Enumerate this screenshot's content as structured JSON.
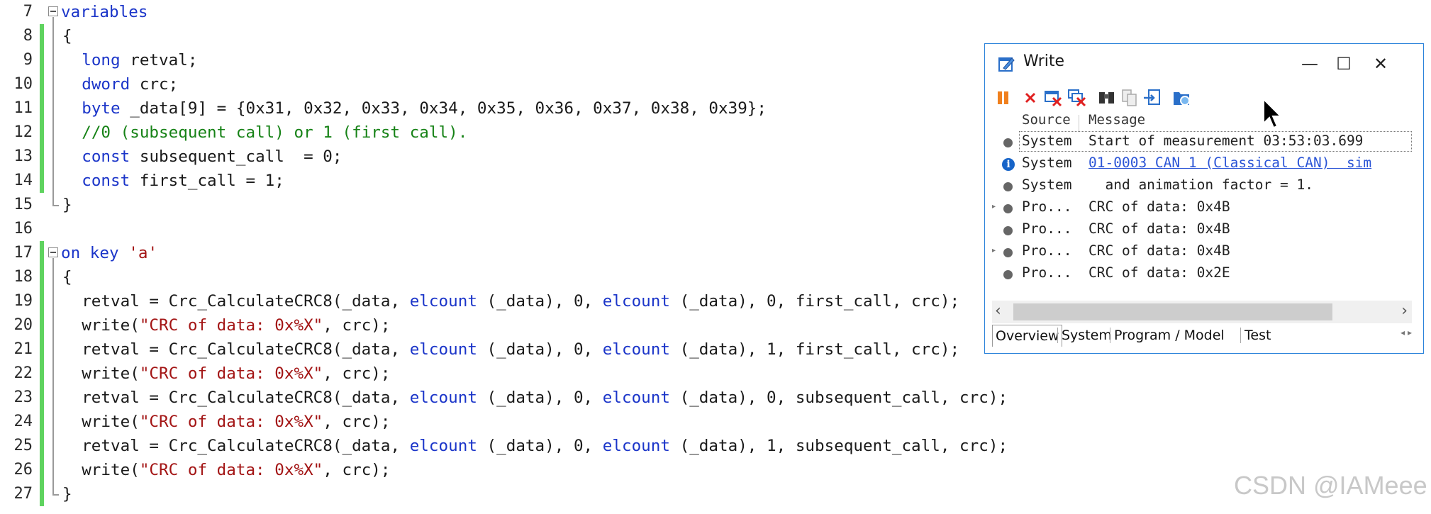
{
  "editor": {
    "lines": [
      {
        "n": "7",
        "tokens": [
          {
            "t": "variables",
            "c": "kw"
          }
        ]
      },
      {
        "n": "8",
        "tokens": [
          {
            "t": "{",
            "c": ""
          }
        ]
      },
      {
        "n": "9",
        "tokens": [
          {
            "t": "  ",
            "c": ""
          },
          {
            "t": "long",
            "c": "kw"
          },
          {
            "t": " retval;",
            "c": ""
          }
        ]
      },
      {
        "n": "10",
        "tokens": [
          {
            "t": "  ",
            "c": ""
          },
          {
            "t": "dword",
            "c": "kw"
          },
          {
            "t": " crc;",
            "c": ""
          }
        ]
      },
      {
        "n": "11",
        "tokens": [
          {
            "t": "  ",
            "c": ""
          },
          {
            "t": "byte",
            "c": "kw"
          },
          {
            "t": " _data[9] = {0x31, 0x32, 0x33, 0x34, 0x35, 0x36, 0x37, 0x38, 0x39};",
            "c": ""
          }
        ]
      },
      {
        "n": "12",
        "tokens": [
          {
            "t": "  ",
            "c": ""
          },
          {
            "t": "//0 (subsequent call) or 1 (first call).",
            "c": "cm"
          }
        ]
      },
      {
        "n": "13",
        "tokens": [
          {
            "t": "  ",
            "c": ""
          },
          {
            "t": "const",
            "c": "kw"
          },
          {
            "t": " subsequent_call  = 0;",
            "c": ""
          }
        ]
      },
      {
        "n": "14",
        "tokens": [
          {
            "t": "  ",
            "c": ""
          },
          {
            "t": "const",
            "c": "kw"
          },
          {
            "t": " first_call = 1;",
            "c": ""
          }
        ]
      },
      {
        "n": "15",
        "tokens": [
          {
            "t": "}",
            "c": ""
          }
        ]
      },
      {
        "n": "16",
        "tokens": []
      },
      {
        "n": "17",
        "tokens": [
          {
            "t": "on key",
            "c": "kw"
          },
          {
            "t": " ",
            "c": ""
          },
          {
            "t": "'a'",
            "c": "st"
          }
        ]
      },
      {
        "n": "18",
        "tokens": [
          {
            "t": "{",
            "c": ""
          }
        ]
      },
      {
        "n": "19",
        "tokens": [
          {
            "t": "  retval = Crc_CalculateCRC8(_data, ",
            "c": ""
          },
          {
            "t": "elcount",
            "c": "kw"
          },
          {
            "t": " (_data), 0, ",
            "c": ""
          },
          {
            "t": "elcount",
            "c": "kw"
          },
          {
            "t": " (_data), 0, first_call, crc);",
            "c": ""
          }
        ]
      },
      {
        "n": "20",
        "tokens": [
          {
            "t": "  write(",
            "c": ""
          },
          {
            "t": "\"CRC of data: 0x%X\"",
            "c": "st"
          },
          {
            "t": ", crc);",
            "c": ""
          }
        ]
      },
      {
        "n": "21",
        "tokens": [
          {
            "t": "  retval = Crc_CalculateCRC8(_data, ",
            "c": ""
          },
          {
            "t": "elcount",
            "c": "kw"
          },
          {
            "t": " (_data), 0, ",
            "c": ""
          },
          {
            "t": "elcount",
            "c": "kw"
          },
          {
            "t": " (_data), 1, first_call, crc);",
            "c": ""
          }
        ]
      },
      {
        "n": "22",
        "tokens": [
          {
            "t": "  write(",
            "c": ""
          },
          {
            "t": "\"CRC of data: 0x%X\"",
            "c": "st"
          },
          {
            "t": ", crc);",
            "c": ""
          }
        ]
      },
      {
        "n": "23",
        "tokens": [
          {
            "t": "  retval = Crc_CalculateCRC8(_data, ",
            "c": ""
          },
          {
            "t": "elcount",
            "c": "kw"
          },
          {
            "t": " (_data), 0, ",
            "c": ""
          },
          {
            "t": "elcount",
            "c": "kw"
          },
          {
            "t": " (_data), 0, subsequent_call, crc);",
            "c": ""
          }
        ]
      },
      {
        "n": "24",
        "tokens": [
          {
            "t": "  write(",
            "c": ""
          },
          {
            "t": "\"CRC of data: 0x%X\"",
            "c": "st"
          },
          {
            "t": ", crc);",
            "c": ""
          }
        ]
      },
      {
        "n": "25",
        "tokens": [
          {
            "t": "  retval = Crc_CalculateCRC8(_data, ",
            "c": ""
          },
          {
            "t": "elcount",
            "c": "kw"
          },
          {
            "t": " (_data), 0, ",
            "c": ""
          },
          {
            "t": "elcount",
            "c": "kw"
          },
          {
            "t": " (_data), 1, subsequent_call, crc);",
            "c": ""
          }
        ]
      },
      {
        "n": "26",
        "tokens": [
          {
            "t": "  write(",
            "c": ""
          },
          {
            "t": "\"CRC of data: 0x%X\"",
            "c": "st"
          },
          {
            "t": ", crc);",
            "c": ""
          }
        ]
      },
      {
        "n": "27",
        "tokens": [
          {
            "t": "}",
            "c": ""
          }
        ]
      }
    ]
  },
  "write_window": {
    "title": "Write",
    "controls": {
      "minimize": "—",
      "maximize": "☐",
      "close": "✕"
    },
    "columns": {
      "source": "Source",
      "message": "Message"
    },
    "rows": [
      {
        "icon": "dot",
        "source": "System",
        "message": "Start of measurement 03:53:03.699",
        "link": false,
        "selected": true
      },
      {
        "icon": "info",
        "source": "System",
        "message": "01-0003 CAN 1 (Classical CAN)  sim",
        "link": true,
        "selected": false
      },
      {
        "icon": "dot",
        "source": "System",
        "message": "  and animation factor = 1.",
        "link": false,
        "selected": false
      },
      {
        "icon": "dot",
        "source": "Pro...",
        "message": "CRC of data: 0x4B",
        "link": false,
        "selected": false
      },
      {
        "icon": "dot",
        "source": "Pro...",
        "message": "CRC of data: 0x4B",
        "link": false,
        "selected": false
      },
      {
        "icon": "dot",
        "source": "Pro...",
        "message": "CRC of data: 0x4B",
        "link": false,
        "selected": false
      },
      {
        "icon": "dot",
        "source": "Pro...",
        "message": "CRC of data: 0x2E",
        "link": false,
        "selected": false
      }
    ],
    "tabs": [
      "Overview",
      "System",
      "Program / Model",
      "Test"
    ],
    "active_tab": "Overview",
    "colors": {
      "border": "#2a82da",
      "link": "#2a54d6",
      "pause": "#f0801e",
      "delete": "#e02020"
    }
  },
  "watermark": "CSDN @IAMeee"
}
